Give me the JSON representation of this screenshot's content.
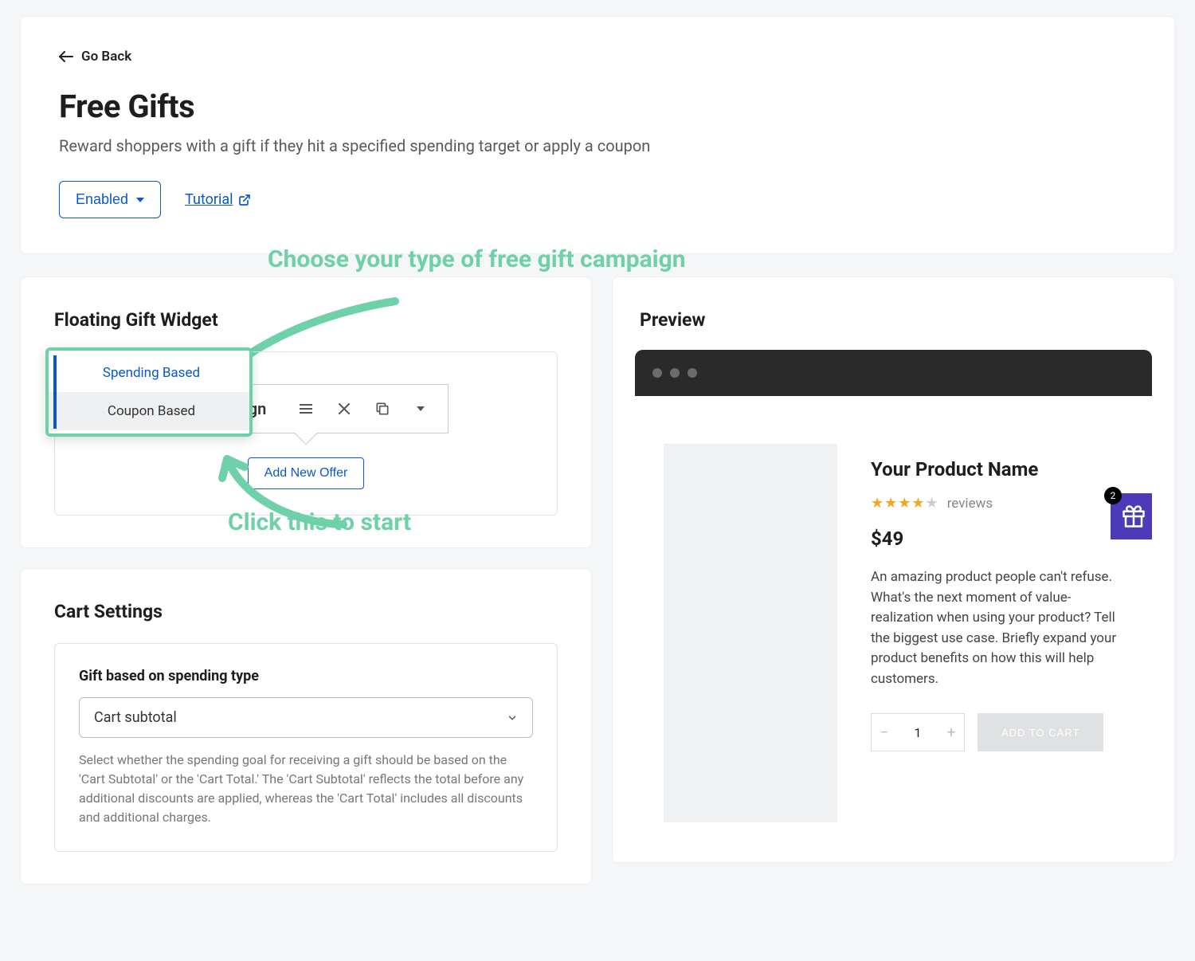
{
  "header": {
    "go_back": "Go Back",
    "title": "Free Gifts",
    "subtitle": "Reward shoppers with a gift if they hit a specified spending target or apply a coupon",
    "enabled_label": "Enabled",
    "tutorial_label": "Tutorial"
  },
  "annotations": {
    "choose_type": "Choose your type of free gift campaign",
    "click_start": "Click this to start"
  },
  "widget": {
    "section_title": "Floating Gift Widget",
    "campaign_partial": "aign",
    "add_offer": "Add New Offer",
    "dropdown": {
      "spending": "Spending Based",
      "coupon": "Coupon Based"
    }
  },
  "cart_settings": {
    "section_title": "Cart Settings",
    "field_label": "Gift based on spending type",
    "select_value": "Cart subtotal",
    "help": "Select whether the spending goal for receiving a gift should be based on the 'Cart Subtotal' or the 'Cart Total.' The 'Cart Subtotal' reflects the total before any additional discounts are applied, whereas the 'Cart Total' includes all discounts and additional charges."
  },
  "preview": {
    "title": "Preview",
    "product_name": "Your Product Name",
    "reviews_label": "reviews",
    "price": "$49",
    "description": "An amazing product people can't refuse. What's the next moment of value-realization when using your product? Tell the biggest use case. Briefly expand your product benefits on how this will help customers.",
    "qty": "1",
    "add_to_cart": "ADD TO CART",
    "gift_badge": "2"
  }
}
